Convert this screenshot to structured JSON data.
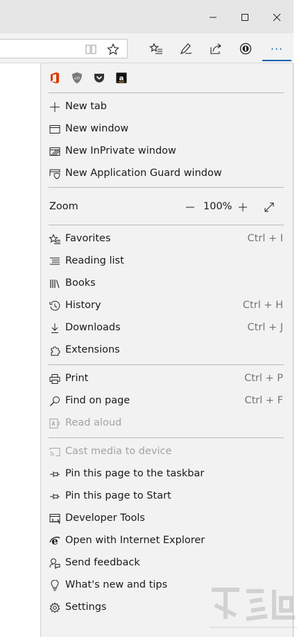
{
  "window": {
    "buttons": [
      "minimize",
      "maximize",
      "close"
    ]
  },
  "toolbar": {
    "icons": [
      "reading-view-icon",
      "favorite-star-icon",
      "favorites-hub-icon",
      "pen-icon",
      "share-icon",
      "password-manager-icon",
      "more-icon"
    ],
    "more_label": "···"
  },
  "extensions": [
    "office-icon",
    "ublock-icon",
    "pocket-icon",
    "amazon-icon"
  ],
  "menu": {
    "group1": [
      {
        "label": "New tab",
        "icon": "plus-icon"
      },
      {
        "label": "New window",
        "icon": "window-icon"
      },
      {
        "label": "New InPrivate window",
        "icon": "inprivate-icon"
      },
      {
        "label": "New Application Guard window",
        "icon": "app-guard-icon"
      }
    ],
    "zoom": {
      "label": "Zoom",
      "value": "100%",
      "minus": "—",
      "plus": "+"
    },
    "group2": [
      {
        "label": "Favorites",
        "shortcut": "Ctrl + I",
        "icon": "favorites-icon"
      },
      {
        "label": "Reading list",
        "shortcut": "",
        "icon": "reading-list-icon"
      },
      {
        "label": "Books",
        "shortcut": "",
        "icon": "books-icon"
      },
      {
        "label": "History",
        "shortcut": "Ctrl + H",
        "icon": "history-icon"
      },
      {
        "label": "Downloads",
        "shortcut": "Ctrl + J",
        "icon": "download-icon"
      },
      {
        "label": "Extensions",
        "shortcut": "",
        "icon": "extensions-icon"
      }
    ],
    "group3": [
      {
        "label": "Print",
        "shortcut": "Ctrl + P",
        "icon": "print-icon"
      },
      {
        "label": "Find on page",
        "shortcut": "Ctrl + F",
        "icon": "search-icon"
      },
      {
        "label": "Read aloud",
        "shortcut": "",
        "icon": "read-aloud-icon",
        "disabled": true
      }
    ],
    "group4": [
      {
        "label": "Cast media to device",
        "icon": "cast-icon",
        "disabled": true
      },
      {
        "label": "Pin this page to the taskbar",
        "icon": "pin-icon"
      },
      {
        "label": "Pin this page to Start",
        "icon": "pin-icon"
      },
      {
        "label": "Developer Tools",
        "icon": "developer-tools-icon"
      },
      {
        "label": "Open with Internet Explorer",
        "icon": "internet-explorer-icon"
      },
      {
        "label": "Send feedback",
        "icon": "feedback-icon"
      },
      {
        "label": "What's new and tips",
        "icon": "lightbulb-icon"
      },
      {
        "label": "Settings",
        "icon": "gear-icon"
      }
    ]
  },
  "colors": {
    "accent": "#0063b1",
    "office": "#d83b01",
    "menu_bg": "#f2f2f2"
  }
}
